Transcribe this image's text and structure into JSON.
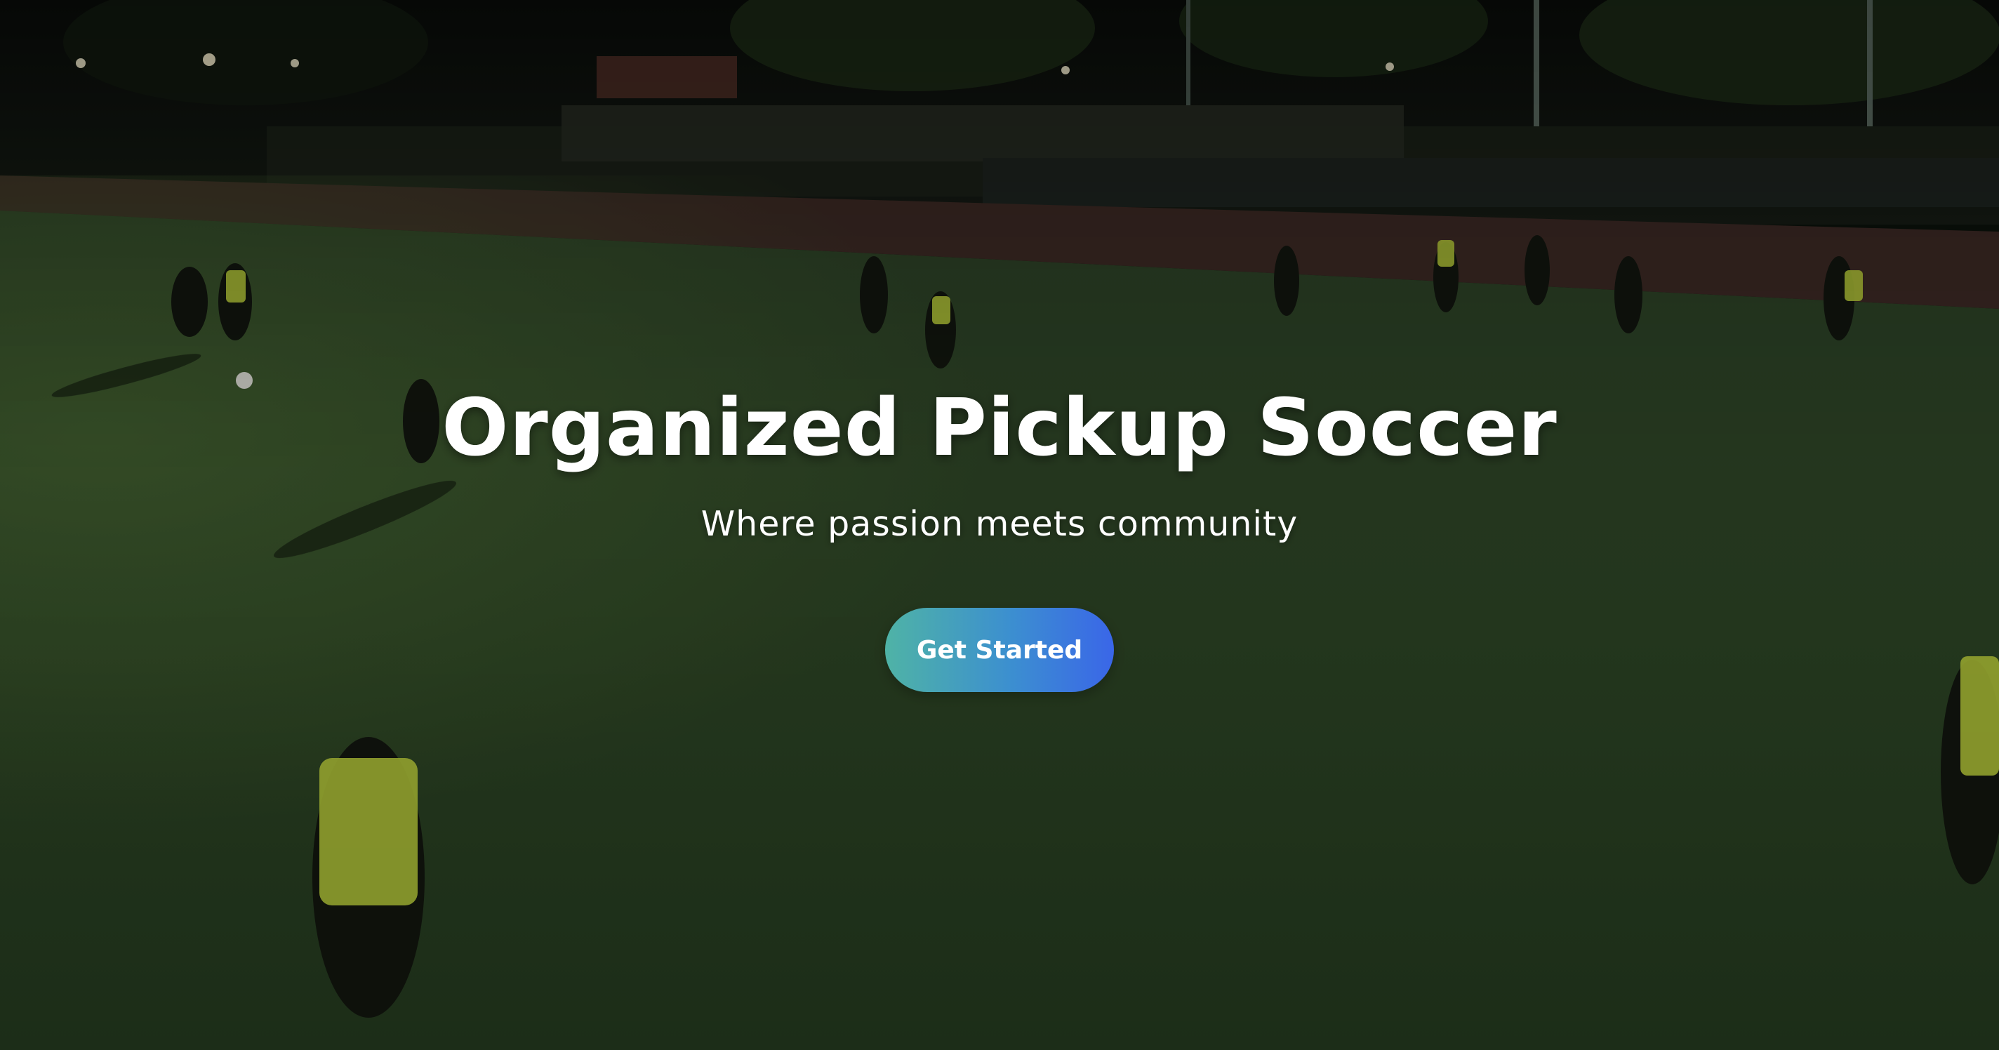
{
  "hero": {
    "title": "Organized Pickup Soccer",
    "subtitle": "Where passion meets community",
    "cta_label": "Get Started",
    "background_image": "night soccer field with players in bibs",
    "colors": {
      "button_gradient_start": "#4fb3a6",
      "button_gradient_end": "#3a66e8",
      "text": "#ffffff",
      "field": "#2b4222"
    }
  }
}
